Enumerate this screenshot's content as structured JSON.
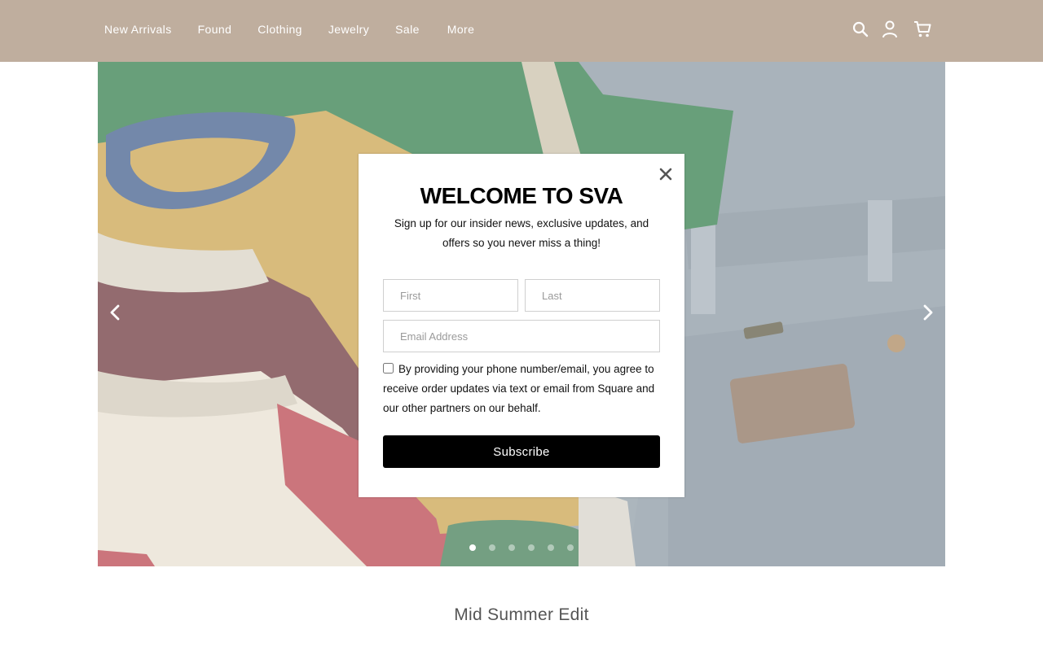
{
  "nav": {
    "links": [
      "New Arrivals",
      "Found",
      "Clothing",
      "Jewelry",
      "Sale",
      "More"
    ],
    "icons": [
      "search-icon",
      "account-icon",
      "cart-icon"
    ],
    "background": "#bfae9e"
  },
  "hero": {
    "slide_count": 6,
    "active_slide": 1,
    "image": "folded vintage tees and denim jeans"
  },
  "modal": {
    "title": "WELCOME TO SVA",
    "subtitle": "Sign up for our insider news, exclusive updates, and offers so you never miss a thing!",
    "first_placeholder": "First",
    "last_placeholder": "Last",
    "email_placeholder": "Email Address",
    "consent": "By providing your phone number/email, you agree to receive order updates via text or email from Square and our other partners on our behalf.",
    "consent_checked": false,
    "subscribe_label": "Subscribe"
  },
  "section": {
    "title": "Mid Summer Edit"
  }
}
